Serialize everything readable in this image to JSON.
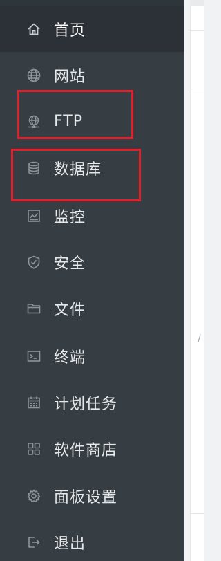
{
  "sidebar": {
    "items": [
      {
        "label": "首页",
        "icon": "home-icon",
        "active": true
      },
      {
        "label": "网站",
        "icon": "globe-icon",
        "active": false
      },
      {
        "label": "FTP",
        "icon": "ftp-icon",
        "active": false
      },
      {
        "label": "数据库",
        "icon": "database-icon",
        "active": false
      },
      {
        "label": "监控",
        "icon": "monitor-chart-icon",
        "active": false
      },
      {
        "label": "安全",
        "icon": "shield-icon",
        "active": false
      },
      {
        "label": "文件",
        "icon": "folder-icon",
        "active": false
      },
      {
        "label": "终端",
        "icon": "terminal-icon",
        "active": false
      },
      {
        "label": "计划任务",
        "icon": "calendar-icon",
        "active": false
      },
      {
        "label": "软件商店",
        "icon": "grid-apps-icon",
        "active": false
      },
      {
        "label": "面板设置",
        "icon": "gear-icon",
        "active": false
      },
      {
        "label": "退出",
        "icon": "logout-icon",
        "active": false
      }
    ]
  },
  "annotations": {
    "highlighted_items": [
      "FTP",
      "数据库"
    ],
    "highlight_color": "#e0202a"
  },
  "colors": {
    "sidebar_bg": "#363e44",
    "active_bg": "#2b3137",
    "text": "#e6e8ea",
    "icon": "#8d949a"
  }
}
